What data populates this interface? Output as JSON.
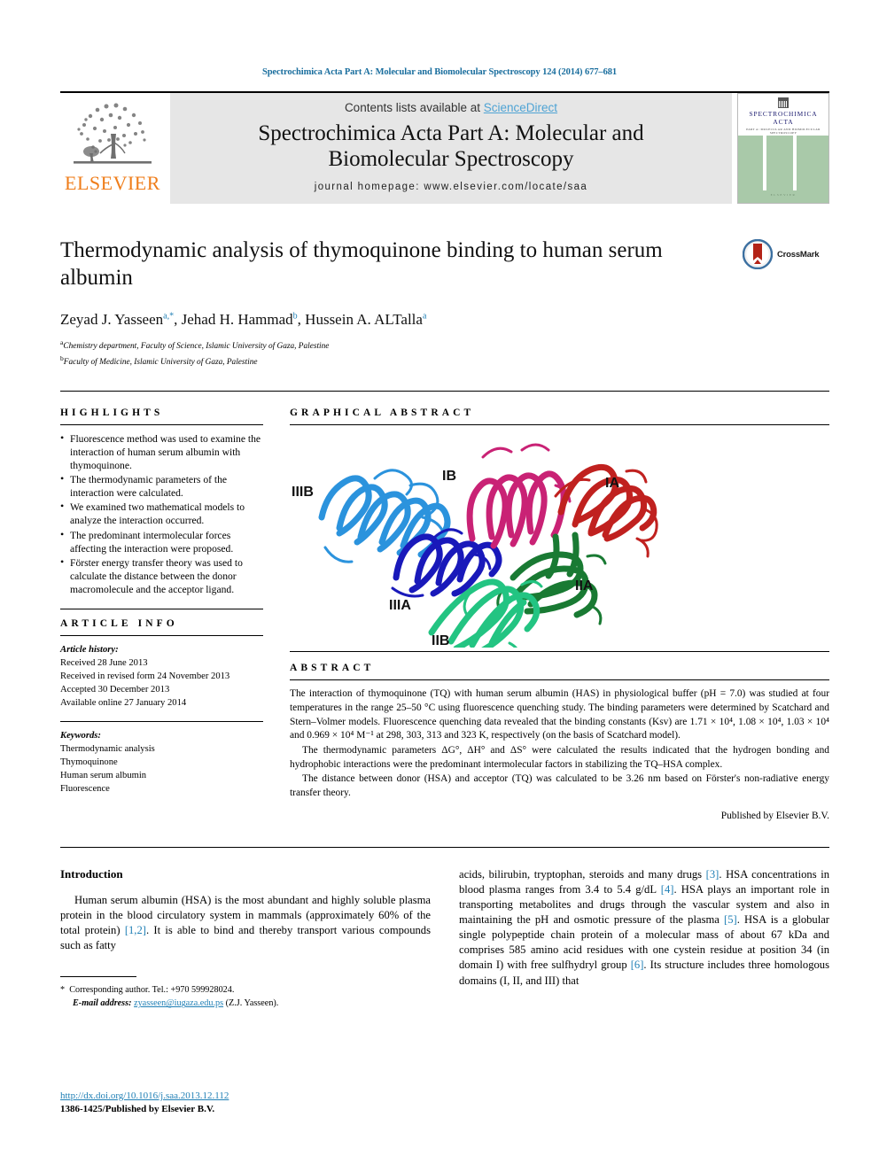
{
  "running_head": "Spectrochimica Acta Part A: Molecular and Biomolecular Spectroscopy 124 (2014) 677–681",
  "masthead": {
    "publisher_name": "ELSEVIER",
    "contents_prefix": "Contents lists available at ",
    "sciencedirect": "ScienceDirect",
    "journal_title_line1": "Spectrochimica Acta Part A: Molecular and",
    "journal_title_line2": "Biomolecular Spectroscopy",
    "homepage": "journal homepage: www.elsevier.com/locate/saa",
    "cover": {
      "title_line1": "SPECTROCHIMICA",
      "title_line2": "ACTA",
      "subtitle": "PART A: MOLECULAR AND BIOMOLECULAR SPECTROSCOPY",
      "footer_dots": "ELSEVIER"
    }
  },
  "article": {
    "title": "Thermodynamic analysis of thymoquinone binding to human serum albumin",
    "authors": [
      {
        "name": "Zeyad J. Yasseen",
        "marks": "a,*"
      },
      {
        "name": "Jehad H. Hammad",
        "marks": "b"
      },
      {
        "name": "Hussein A. ALTalla",
        "marks": "a"
      }
    ],
    "affiliations": [
      {
        "mark": "a",
        "text": "Chemistry department, Faculty of Science, Islamic University of Gaza, Palestine"
      },
      {
        "mark": "b",
        "text": "Faculty of Medicine, Islamic University of Gaza, Palestine"
      }
    ],
    "crossmark_label": "CrossMark"
  },
  "highlights": {
    "heading": "HIGHLIGHTS",
    "items": [
      "Fluorescence method was used to examine the interaction of human serum albumin with thymoquinone.",
      "The thermodynamic parameters of the interaction were calculated.",
      "We examined two mathematical models to analyze the interaction occurred.",
      "The predominant intermolecular forces affecting the interaction were proposed.",
      "Förster energy transfer theory was used to calculate the distance between the donor macromolecule and the acceptor ligand."
    ]
  },
  "graphical_abstract": {
    "heading": "GRAPHICAL ABSTRACT",
    "domain_labels": [
      "IIIB",
      "IB",
      "IA",
      "IIIA",
      "IIA",
      "IIB"
    ],
    "domain_colors": {
      "IIIB": "#1f8fd6",
      "IIIA": "#1414b4",
      "IB": "#c21f6e",
      "IA": "#b81f20",
      "IIA": "#1f7a35",
      "IIB": "#22c07a"
    }
  },
  "article_info": {
    "heading": "ARTICLE INFO",
    "history_label": "Article history:",
    "history": [
      "Received 28 June 2013",
      "Received in revised form 24 November 2013",
      "Accepted 30 December 2013",
      "Available online 27 January 2014"
    ],
    "keywords_label": "Keywords:",
    "keywords": [
      "Thermodynamic analysis",
      "Thymoquinone",
      "Human serum albumin",
      "Fluorescence"
    ]
  },
  "abstract": {
    "heading": "ABSTRACT",
    "paragraph1": "The interaction of thymoquinone (TQ) with human serum albumin (HAS) in physiological buffer (pH = 7.0) was studied at four temperatures in the range 25–50 °C using fluorescence quenching study. The binding parameters were determined by Scatchard and Stern–Volmer models. Fluorescence quenching data revealed that the binding constants (Ksv) are 1.71 × 10⁴, 1.08 × 10⁴, 1.03 × 10⁴ and 0.969 × 10⁴ M⁻¹ at 298, 303, 313 and 323 K, respectively (on the basis of Scatchard model).",
    "paragraph2": "The thermodynamic parameters ΔG°, ΔH° and ΔS° were calculated the results indicated that the hydrogen bonding and hydrophobic interactions were the predominant intermolecular factors in stabilizing the TQ–HSA complex.",
    "paragraph3": "The distance between donor (HSA) and acceptor (TQ) was calculated to be 3.26 nm based on Förster's non-radiative energy transfer theory.",
    "published_by": "Published by Elsevier B.V."
  },
  "body": {
    "section_title": "Introduction",
    "left_paragraph": "Human serum albumin (HSA) is the most abundant and highly soluble plasma protein in the blood circulatory system in mammals (approximately 60% of the total protein) [1,2]. It is able to bind and thereby transport various compounds such as fatty",
    "right_paragraph": "acids, bilirubin, tryptophan, steroids and many drugs [3]. HSA concentrations in blood plasma ranges from 3.4 to 5.4 g/dL [4]. HSA plays an important role in transporting metabolites and drugs through the vascular system and also in maintaining the pH and osmotic pressure of the plasma [5]. HSA is a globular single polypeptide chain protein of a molecular mass of about 67 kDa and comprises 585 amino acid residues with one cystein residue at position 34 (in domain I) with free sulfhydryl group [6]. Its structure includes three homologous domains (I, II, and III) that"
  },
  "footnote": {
    "corresponding": "Corresponding author. Tel.: +970 599928024.",
    "email_label": "E-mail address:",
    "email": "zyasseen@iugaza.edu.ps",
    "email_suffix": "(Z.J. Yasseen)."
  },
  "footer": {
    "doi": "http://dx.doi.org/10.1016/j.saa.2013.12.112",
    "issn_line": "1386-1425/Published by Elsevier B.V."
  },
  "colors": {
    "link_blue": "#1f7fb5",
    "sciencedirect_blue": "#4ea3d4",
    "elsevier_orange": "#ef7d1a",
    "masthead_gray": "#e6e6e6"
  }
}
